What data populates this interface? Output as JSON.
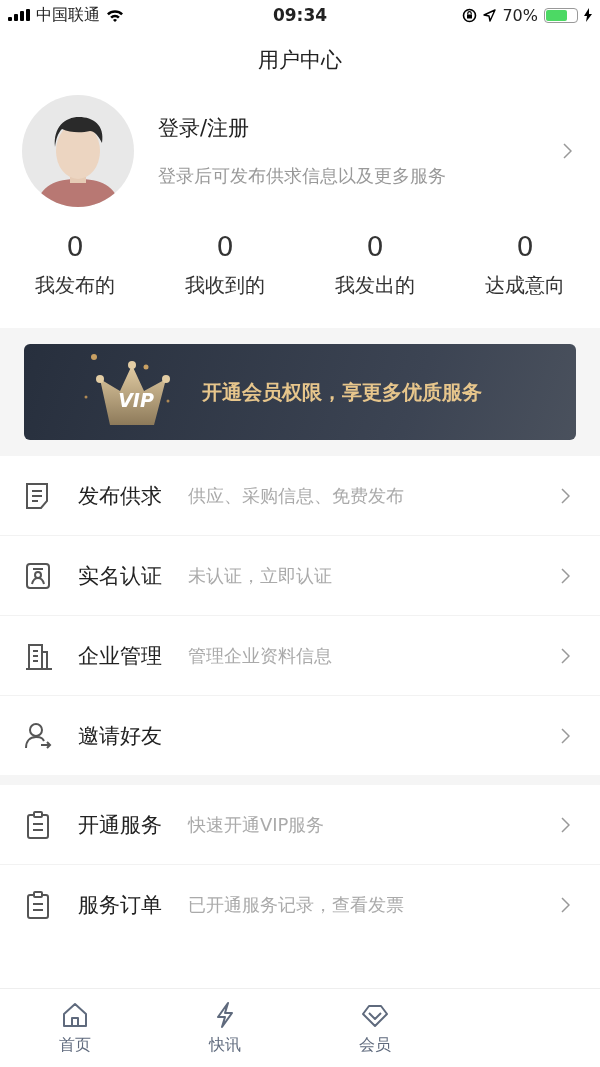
{
  "status_bar": {
    "carrier": "中国联通",
    "time": "09:34",
    "battery": "70%"
  },
  "title": "用户中心",
  "profile": {
    "name": "登录/注册",
    "subtitle": "登录后可发布供求信息以及更多服务"
  },
  "stats": [
    {
      "value": "0",
      "label": "我发布的"
    },
    {
      "value": "0",
      "label": "我收到的"
    },
    {
      "value": "0",
      "label": "我发出的"
    },
    {
      "value": "0",
      "label": "达成意向"
    }
  ],
  "vip_banner": {
    "badge": "VIP",
    "text": "开通会员权限，享更多优质服务"
  },
  "menu_groups": [
    [
      {
        "label": "发布供求",
        "hint": "供应、采购信息、免费发布"
      },
      {
        "label": "实名认证",
        "hint": "未认证，立即认证"
      },
      {
        "label": "企业管理",
        "hint": "管理企业资料信息"
      },
      {
        "label": "邀请好友"
      }
    ],
    [
      {
        "label": "开通服务",
        "hint": "快速开通VIP服务"
      },
      {
        "label": "服务订单",
        "hint": "已开通服务记录，查看发票"
      }
    ]
  ],
  "tabs": [
    {
      "label": "首页"
    },
    {
      "label": "快讯"
    },
    {
      "label": "会员"
    }
  ]
}
